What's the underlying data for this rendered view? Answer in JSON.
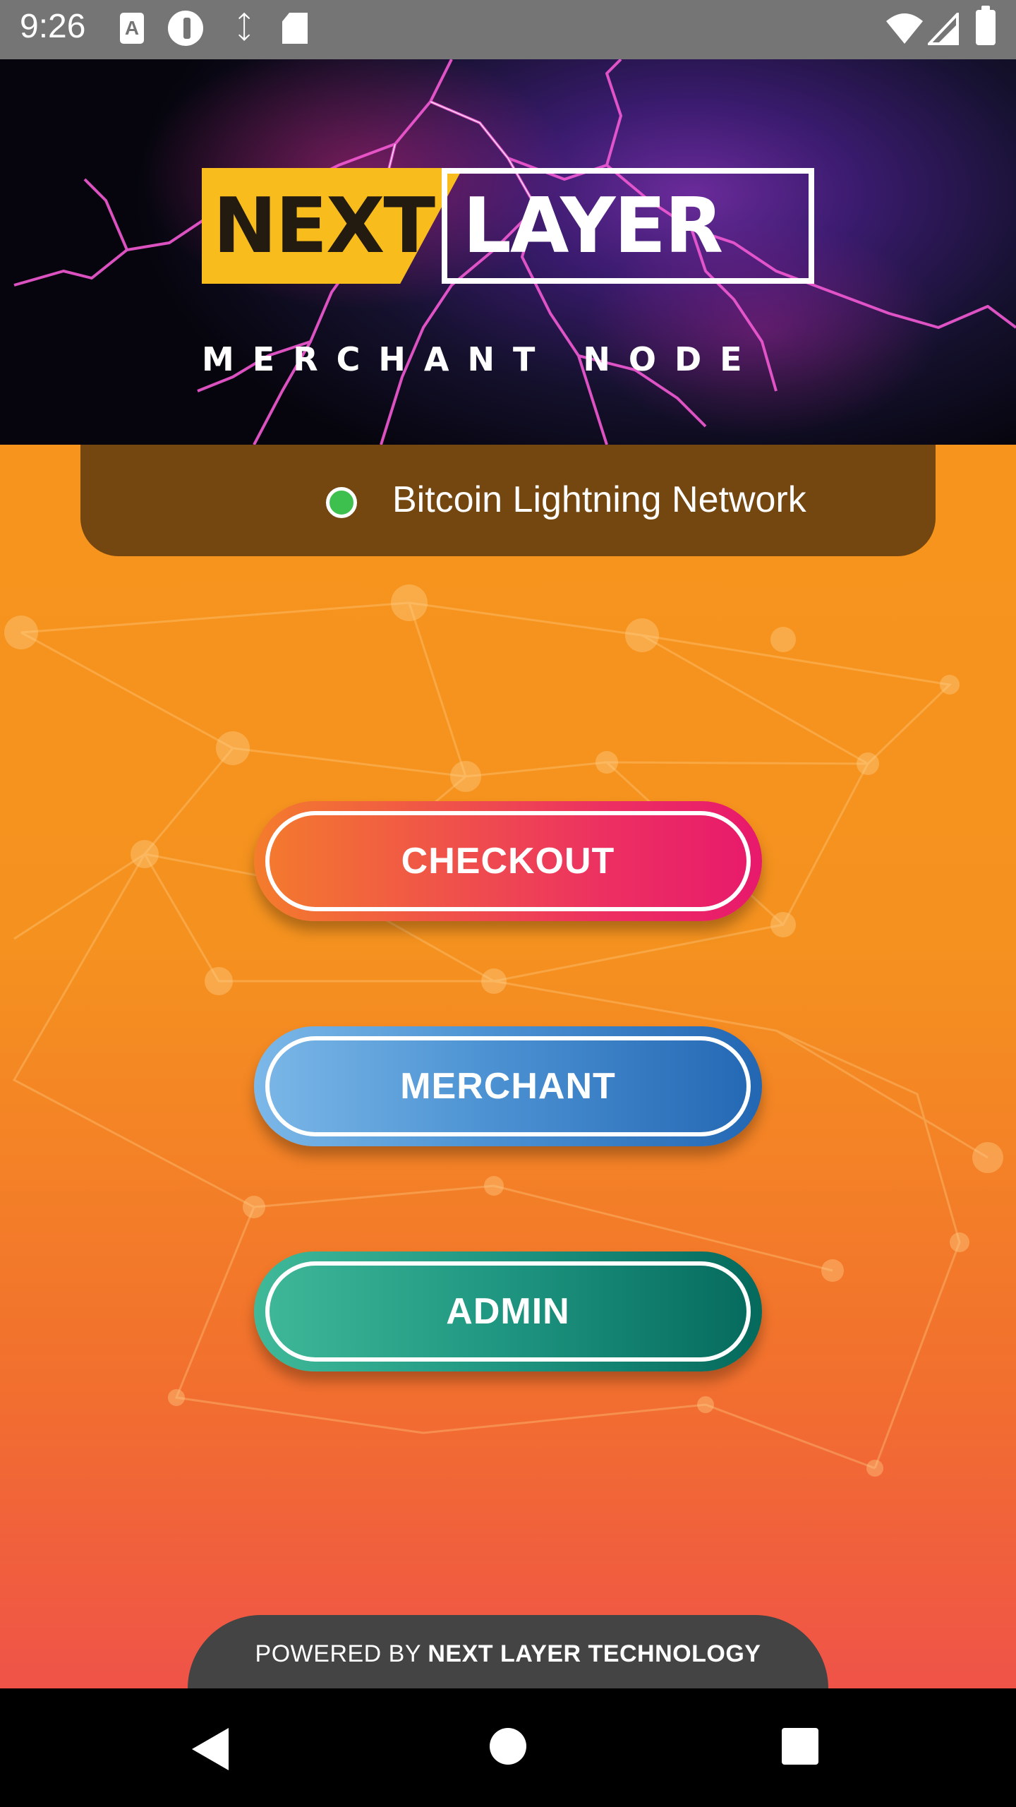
{
  "status_bar": {
    "time": "9:26",
    "icons": [
      "text-a-icon",
      "p-badge-icon",
      "sync-icon",
      "sd-card-icon",
      "wifi-icon",
      "signal-icon",
      "battery-icon"
    ]
  },
  "banner": {
    "logo_word_1": "NEXT",
    "logo_word_2": "LAYER",
    "logo_subtitle": "MERCHANT NODE"
  },
  "network": {
    "label": "Bitcoin Lightning Network",
    "status_color": "#3dc04e"
  },
  "buttons": {
    "checkout": "CHECKOUT",
    "merchant": "MERCHANT",
    "admin": "ADMIN"
  },
  "footer": {
    "powered_prefix": "POWERED BY",
    "powered_brand": "NEXT LAYER TECHNOLOGY"
  },
  "colors": {
    "accent_orange": "#f7941d",
    "network_pill": "#744610",
    "checkout": "#e8196c",
    "merchant": "#2367b3",
    "admin": "#05695c"
  },
  "nav_bar": {
    "icons": [
      "back-icon",
      "home-icon",
      "recents-icon"
    ]
  }
}
